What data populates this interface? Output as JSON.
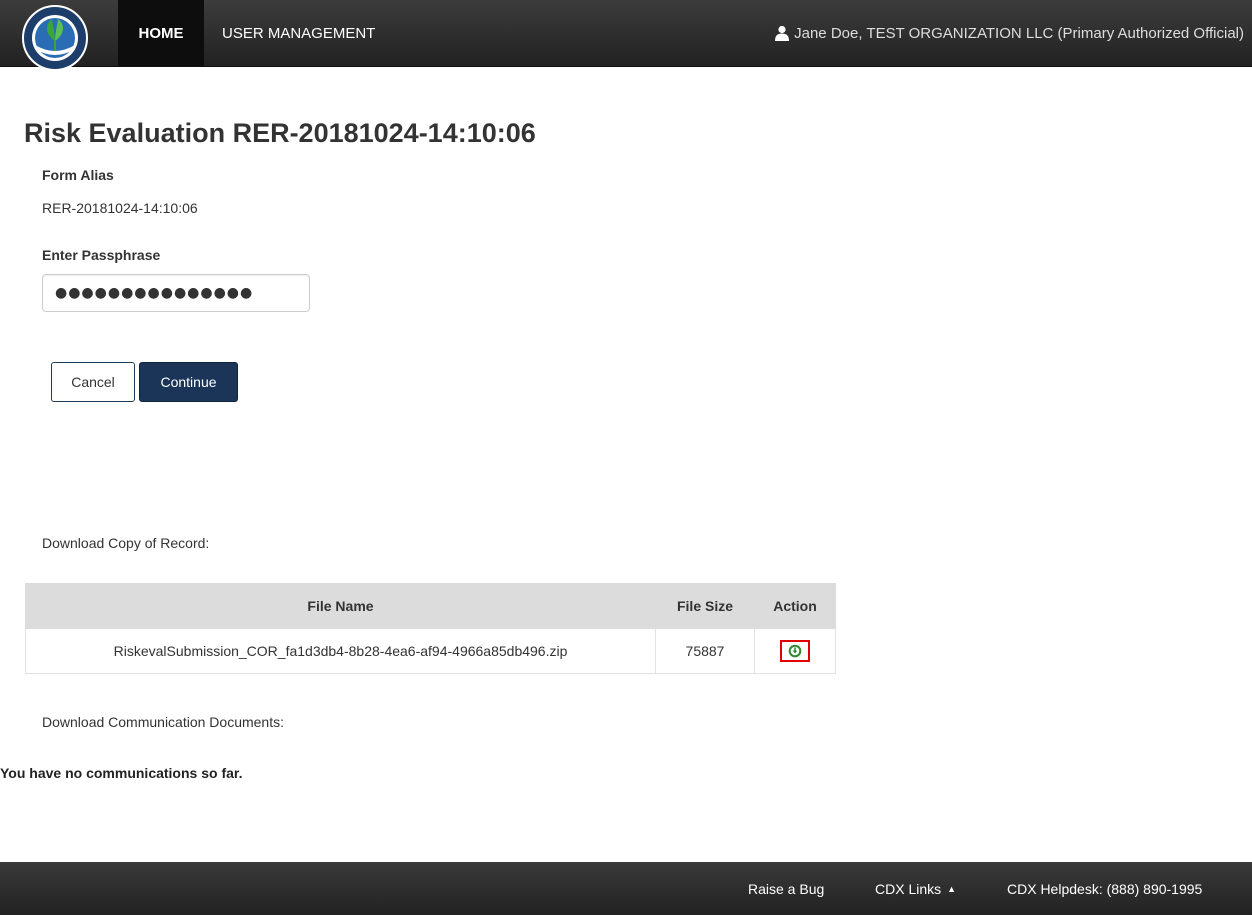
{
  "nav": {
    "home_label": "HOME",
    "user_management_label": "USER MANAGEMENT",
    "user_label": "Jane Doe, TEST ORGANIZATION LLC (Primary Authorized Official)"
  },
  "page": {
    "title": "Risk Evaluation RER-20181024-14:10:06",
    "form_alias_label": "Form Alias",
    "form_alias_value": "RER-20181024-14:10:06",
    "passphrase_label": "Enter Passphrase",
    "passphrase_value": "●●●●●●●●●●●●●●●",
    "cancel_label": "Cancel",
    "continue_label": "Continue",
    "copy_of_record_label": "Download Copy of Record:",
    "communications_label": "Download Communication Documents:",
    "no_communications": "You have no communications so far."
  },
  "table": {
    "headers": [
      "File Name",
      "File Size",
      "Action"
    ],
    "rows": [
      {
        "file_name": "RiskevalSubmission_COR_fa1d3db4-8b28-4ea6-af94-4966a85db496.zip",
        "file_size": "75887",
        "action_icon": "download-icon"
      }
    ]
  },
  "footer": {
    "raise_bug": "Raise a Bug",
    "cdx_links": "CDX Links",
    "helpdesk": "CDX Helpdesk: (888) 890-1995"
  },
  "colors": {
    "navbar": "#2b2b2b",
    "primary_button": "#1a3557",
    "download_icon": "#2e8b2e",
    "highlight_border": "#e00000",
    "table_header": "#dcdcdc"
  }
}
